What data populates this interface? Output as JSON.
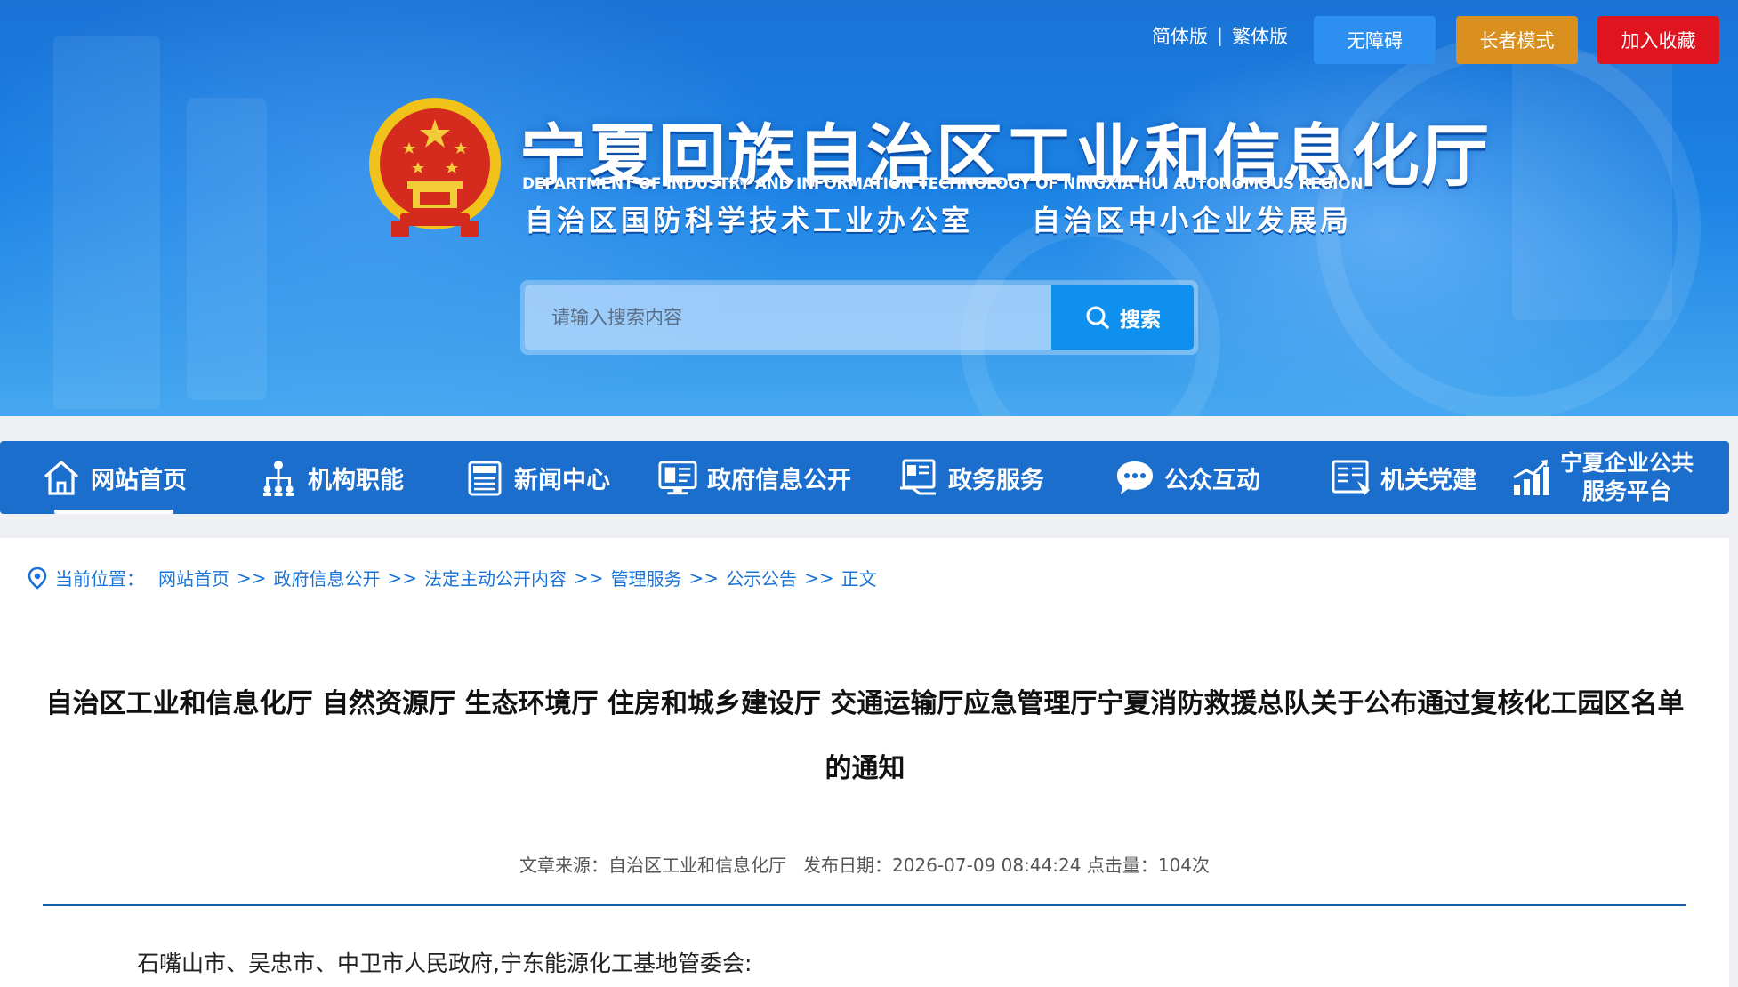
{
  "header": {
    "lang_simplified": "简体版",
    "lang_separator": "|",
    "lang_traditional": "繁体版",
    "accessibility": "无障碍",
    "elder_mode": "长者模式",
    "favorite": "加入收藏",
    "site_title": "宁夏回族自治区工业和信息化厅",
    "site_title_en": "DEPARTMENT OF INDUSTRY AND INFORMATION TECHNOLOGY OF NINGXIA HUI AUTONOMOUS REGION",
    "subtitle_left": "自治区国防科学技术工业办公室",
    "subtitle_right": "自治区中小企业发展局"
  },
  "search": {
    "placeholder": "请输入搜索内容",
    "button_label": "搜索"
  },
  "nav": {
    "items": [
      {
        "label": "网站首页",
        "icon": "home-icon"
      },
      {
        "label": "机构职能",
        "icon": "org-chart-icon"
      },
      {
        "label": "新闻中心",
        "icon": "news-icon"
      },
      {
        "label": "政府信息公开",
        "icon": "monitor-icon"
      },
      {
        "label": "政务服务",
        "icon": "service-icon"
      },
      {
        "label": "公众互动",
        "icon": "chat-icon"
      },
      {
        "label": "机关党建",
        "icon": "book-icon"
      }
    ],
    "last_line1": "宁夏企业公共",
    "last_line2": "服务平台"
  },
  "breadcrumb": {
    "label": "当前位置：",
    "separator": ">>",
    "items": [
      "网站首页",
      "政府信息公开",
      "法定主动公开内容",
      "管理服务",
      "公示公告",
      "正文"
    ]
  },
  "article": {
    "title": "自治区工业和信息化厅 自然资源厅 生态环境厅 住房和城乡建设厅 交通运输厅应急管理厅宁夏消防救援总队关于公布通过复核化工园区名单的通知",
    "meta": "文章来源：自治区工业和信息化厅   发布日期：2026-07-09 08:44:24 点击量：104次",
    "first_paragraph": "石嘴山市、吴忠市、中卫市人民政府,宁东能源化工基地管委会:"
  },
  "colors": {
    "nav_bg": "#1b6ecc",
    "accessibility_bg": "#2d8ff0",
    "elder_bg": "#d9901f",
    "favorite_bg": "#e0141f",
    "search_btn_bg": "#0f90ee"
  }
}
